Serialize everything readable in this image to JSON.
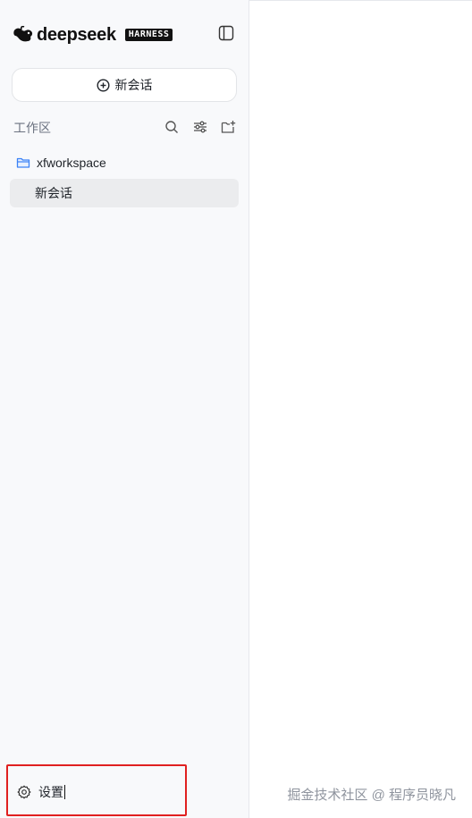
{
  "brand": {
    "name": "deepseek",
    "badge": "HARNESS"
  },
  "new_chat": {
    "label": "新会话"
  },
  "workspace": {
    "title": "工作区"
  },
  "folder": {
    "name": "xfworkspace"
  },
  "sessions": [
    {
      "label": "新会话"
    }
  ],
  "settings": {
    "label": "设置"
  },
  "watermark": {
    "text": "掘金技术社区 @ 程序员晓凡"
  },
  "colors": {
    "accent_folder": "#3b82f6",
    "highlight_border": "#e02020",
    "sidebar_bg": "#f8f9fb"
  }
}
